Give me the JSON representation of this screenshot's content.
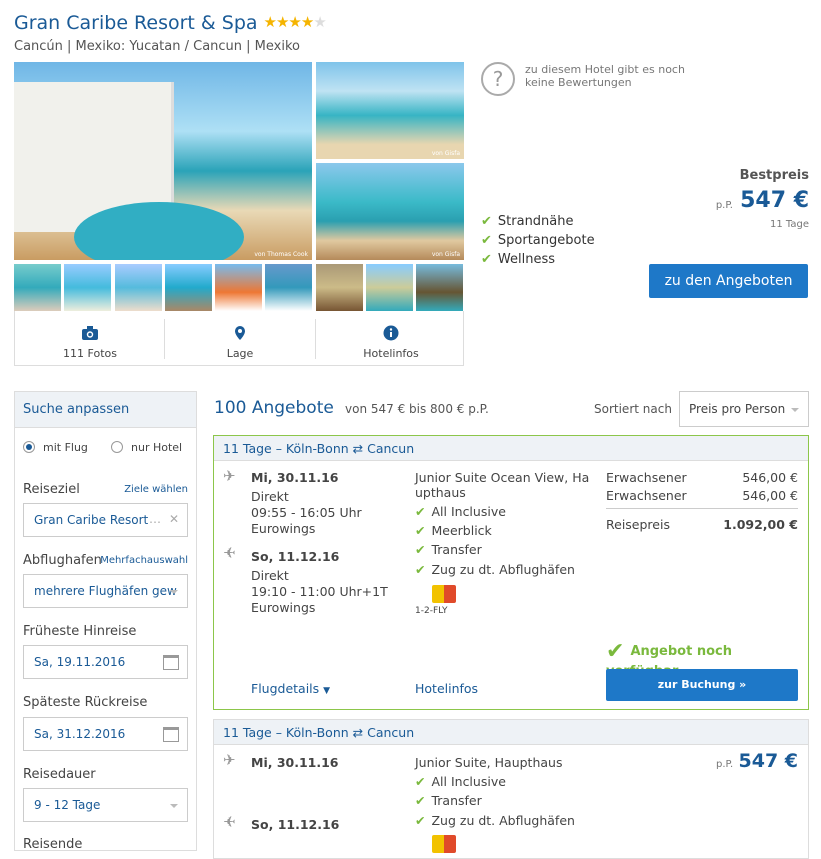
{
  "hotel": {
    "name": "Gran Caribe Resort & Spa",
    "rating_stars": 4.5,
    "location": "Cancún | Mexiko: Yucatan / Cancun | Mexiko"
  },
  "gallery": {
    "main_credit": "von Thomas Cook",
    "side_credits": [
      "von Gisfa",
      "von Gisfa"
    ],
    "tabs": [
      {
        "label": "111 Fotos",
        "icon": "camera-icon"
      },
      {
        "label": "Lage",
        "icon": "map-pin-icon"
      },
      {
        "label": "Hotelinfos",
        "icon": "info-icon"
      }
    ]
  },
  "reviews": {
    "text": "zu diesem Hotel gibt es noch keine Bewertungen"
  },
  "features": [
    "Strandnähe",
    "Sportangebote",
    "Wellness"
  ],
  "price": {
    "label": "Bestpreis",
    "per": "p.P.",
    "amount": "547 €",
    "duration": "11 Tage",
    "button": "zu den Angeboten"
  },
  "sidebar": {
    "title": "Suche anpassen",
    "radio_flight": "mit Flug",
    "radio_hotel": "nur Hotel",
    "destination_label": "Reiseziel",
    "destination_link": "Ziele wählen",
    "destination_value": "Gran Caribe Resort",
    "destination_tail": "…",
    "airport_label": "Abflughafen",
    "airport_link": "Mehrfachauswahl",
    "airport_value": "mehrere Flughäfen gew",
    "earliest_label": "Früheste Hinreise",
    "earliest_value": "Sa, 19.11.2016",
    "latest_label": "Späteste Rückreise",
    "latest_value": "Sa, 31.12.2016",
    "duration_label": "Reisedauer",
    "duration_value": "9 - 12 Tage",
    "travelers_label": "Reisende"
  },
  "results": {
    "count": "100 Angebote",
    "range": "von 547 € bis 800 € p.P.",
    "sort_label": "Sortiert nach",
    "sort_value": "Preis pro Person"
  },
  "offers": [
    {
      "header": "11 Tage – Köln-Bonn ⇄ Cancun",
      "out_date": "Mi, 30.11.16",
      "out_type": "Direkt",
      "out_time": "09:55 - 16:05 Uhr",
      "out_airline": "Eurowings",
      "ret_date": "So, 11.12.16",
      "ret_type": "Direkt",
      "ret_time": "19:10 - 11:00 Uhr+1T",
      "ret_airline": "Eurowings",
      "room_line1": "Junior Suite Ocean View, Ha",
      "room_line2": "upthaus",
      "inclusions": [
        "All Inclusive",
        "Meerblick",
        "Transfer",
        "Zug zu dt. Abflughäfen"
      ],
      "operator": "1-2-FLY",
      "price_rows": [
        {
          "label": "Erwachsener",
          "value": "546,00 €"
        },
        {
          "label": "Erwachsener",
          "value": "546,00 €"
        }
      ],
      "total_label": "Reisepreis",
      "total_value": "1.092,00 €",
      "availability": "Angebot noch verfügbar",
      "flight_details": "Flugdetails",
      "hotel_info": "Hotelinfos",
      "book_button": "zur Buchung »"
    },
    {
      "header": "11 Tage – Köln-Bonn ⇄ Cancun",
      "out_date": "Mi, 30.11.16",
      "ret_date": "So, 11.12.16",
      "room_line1": "Junior Suite, Haupthaus",
      "inclusions": [
        "All Inclusive",
        "Transfer",
        "Zug zu dt. Abflughäfen"
      ],
      "per": "p.P.",
      "price": "547 €"
    }
  ]
}
